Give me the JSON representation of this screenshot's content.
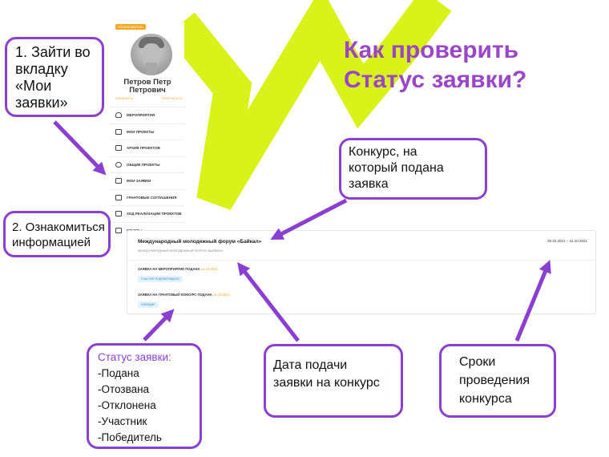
{
  "heading": {
    "line1": "Как проверить",
    "line2": "Статус заявки?"
  },
  "sidebar": {
    "badge": "ПОЛЬЗОВАТЕЛЬ",
    "name_line1": "Петров Петр",
    "name_line2": "Петрович",
    "action_left": "ИЗМЕНИТЬ",
    "action_right": "ПРИГЛАСИТЬ",
    "items": [
      {
        "label": "МЕРОПРИЯТИЯ",
        "icon": "bulb-icon"
      },
      {
        "label": "МОИ ПРОЕКТЫ",
        "icon": "projects-icon"
      },
      {
        "label": "АРХИВ ПРОЕКТОВ",
        "icon": "folder-icon"
      },
      {
        "label": "ОБЩИЕ ПРОЕКТЫ",
        "icon": "users-icon"
      },
      {
        "label": "МОИ ЗАЯВКИ",
        "icon": "checkbox-icon"
      },
      {
        "label": "ГРАНТОВЫЕ СОГЛАШЕНИЯ",
        "icon": "document-icon"
      },
      {
        "label": "ХОД РЕАЛИЗАЦИИ ПРОЕКТОВ",
        "icon": "progress-icon"
      },
      {
        "label": "ОТЧЕТЫ",
        "icon": "report-icon"
      }
    ]
  },
  "card": {
    "title": "Международный молодежный форум «Байкал»",
    "subtitle": "МЕЖДУНАРОДНЫЙ МОЛОДЕЖНЫЙ ФОРУМ «БАЙКАЛ»",
    "dates": "28.10.2021 – 31.10.2021",
    "row1_label": "ЗАЯВКА НА МЕРОПРИЯТИЕ ПОДАНА",
    "row1_date": "14.10.2021",
    "row1_chip": "УЧАСТИЕ ПОДТВЕРЖДЕНО",
    "row2_label": "ЗАЯВКА НА ГРАНТОВЫЙ КОНКУРС ПОДАНА",
    "row2_date": "15.10.2021",
    "row2_chip": "ПОБЕДИЛ"
  },
  "callouts": {
    "step1": "1. Зайти во\nвкладку\n«Мои\nзаявки»",
    "step2": "2. Ознакомиться\nинформацией",
    "contest": "Конкурс, на\nкоторый подана\nзаявка",
    "status_title": "Статус заявки:",
    "status_list": "-Подана\n-Отозвана\n-Отклонена\n-Участник\n-Победитель",
    "submit_date": "Дата подачи\nзаявки на конкурс",
    "period": "Сроки\nпроведения\nконкурса"
  },
  "colors": {
    "purple": "#8a3fd1",
    "title_purple": "#9a46c7",
    "lime": "#d8f21a",
    "orange": "#f5a623",
    "chip_blue": "#2a8bc9"
  }
}
